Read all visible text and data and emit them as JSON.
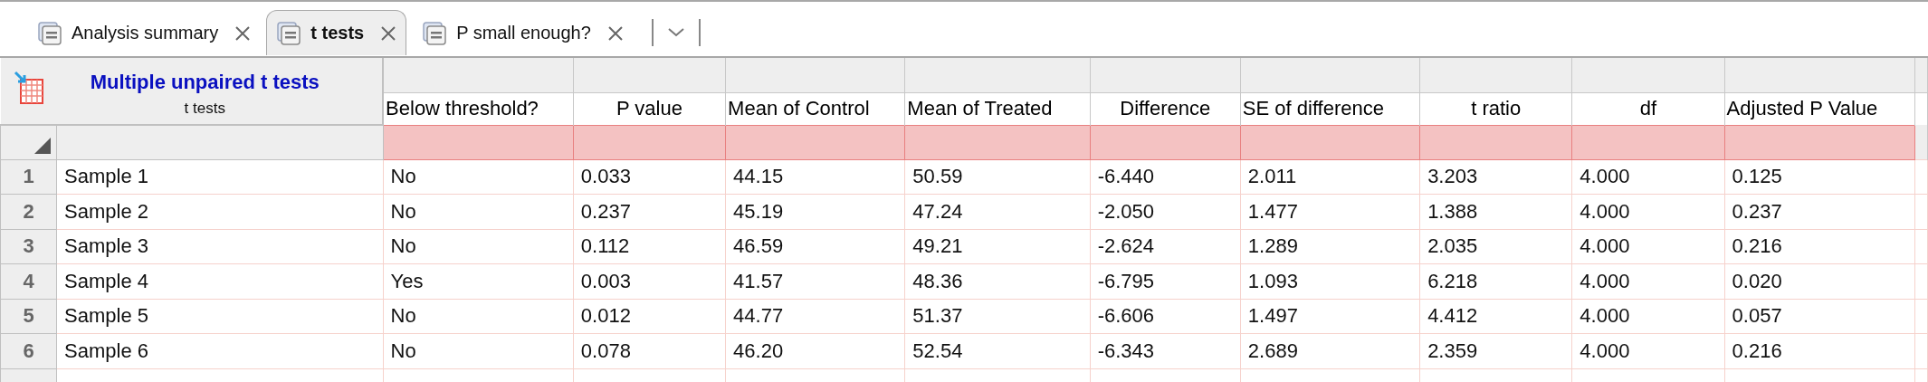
{
  "tabs": [
    {
      "label": "Analysis summary",
      "selected": false
    },
    {
      "label": "t tests",
      "selected": true
    },
    {
      "label": "P small enough?",
      "selected": false
    }
  ],
  "sheet": {
    "title": "Multiple unpaired t tests",
    "subtitle": "t tests"
  },
  "table": {
    "columns": [
      "Below threshold?",
      "P value",
      "Mean of Control",
      "Mean of Treated",
      "Difference",
      "SE of difference",
      "t ratio",
      "df",
      "Adjusted P Value"
    ],
    "rows": [
      {
        "number": "1",
        "label": "Sample 1",
        "cells": [
          "No",
          "0.033",
          "44.15",
          "50.59",
          "-6.440",
          "2.011",
          "3.203",
          "4.000",
          "0.125"
        ]
      },
      {
        "number": "2",
        "label": "Sample 2",
        "cells": [
          "No",
          "0.237",
          "45.19",
          "47.24",
          "-2.050",
          "1.477",
          "1.388",
          "4.000",
          "0.237"
        ]
      },
      {
        "number": "3",
        "label": "Sample 3",
        "cells": [
          "No",
          "0.112",
          "46.59",
          "49.21",
          "-2.624",
          "1.289",
          "2.035",
          "4.000",
          "0.216"
        ]
      },
      {
        "number": "4",
        "label": "Sample 4",
        "cells": [
          "Yes",
          "0.003",
          "41.57",
          "48.36",
          "-6.795",
          "1.093",
          "6.218",
          "4.000",
          "0.020"
        ]
      },
      {
        "number": "5",
        "label": "Sample 5",
        "cells": [
          "No",
          "0.012",
          "44.77",
          "51.37",
          "-6.606",
          "1.497",
          "4.412",
          "4.000",
          "0.057"
        ]
      },
      {
        "number": "6",
        "label": "Sample 6",
        "cells": [
          "No",
          "0.078",
          "46.20",
          "52.54",
          "-6.343",
          "2.689",
          "2.359",
          "4.000",
          "0.216"
        ]
      }
    ]
  }
}
